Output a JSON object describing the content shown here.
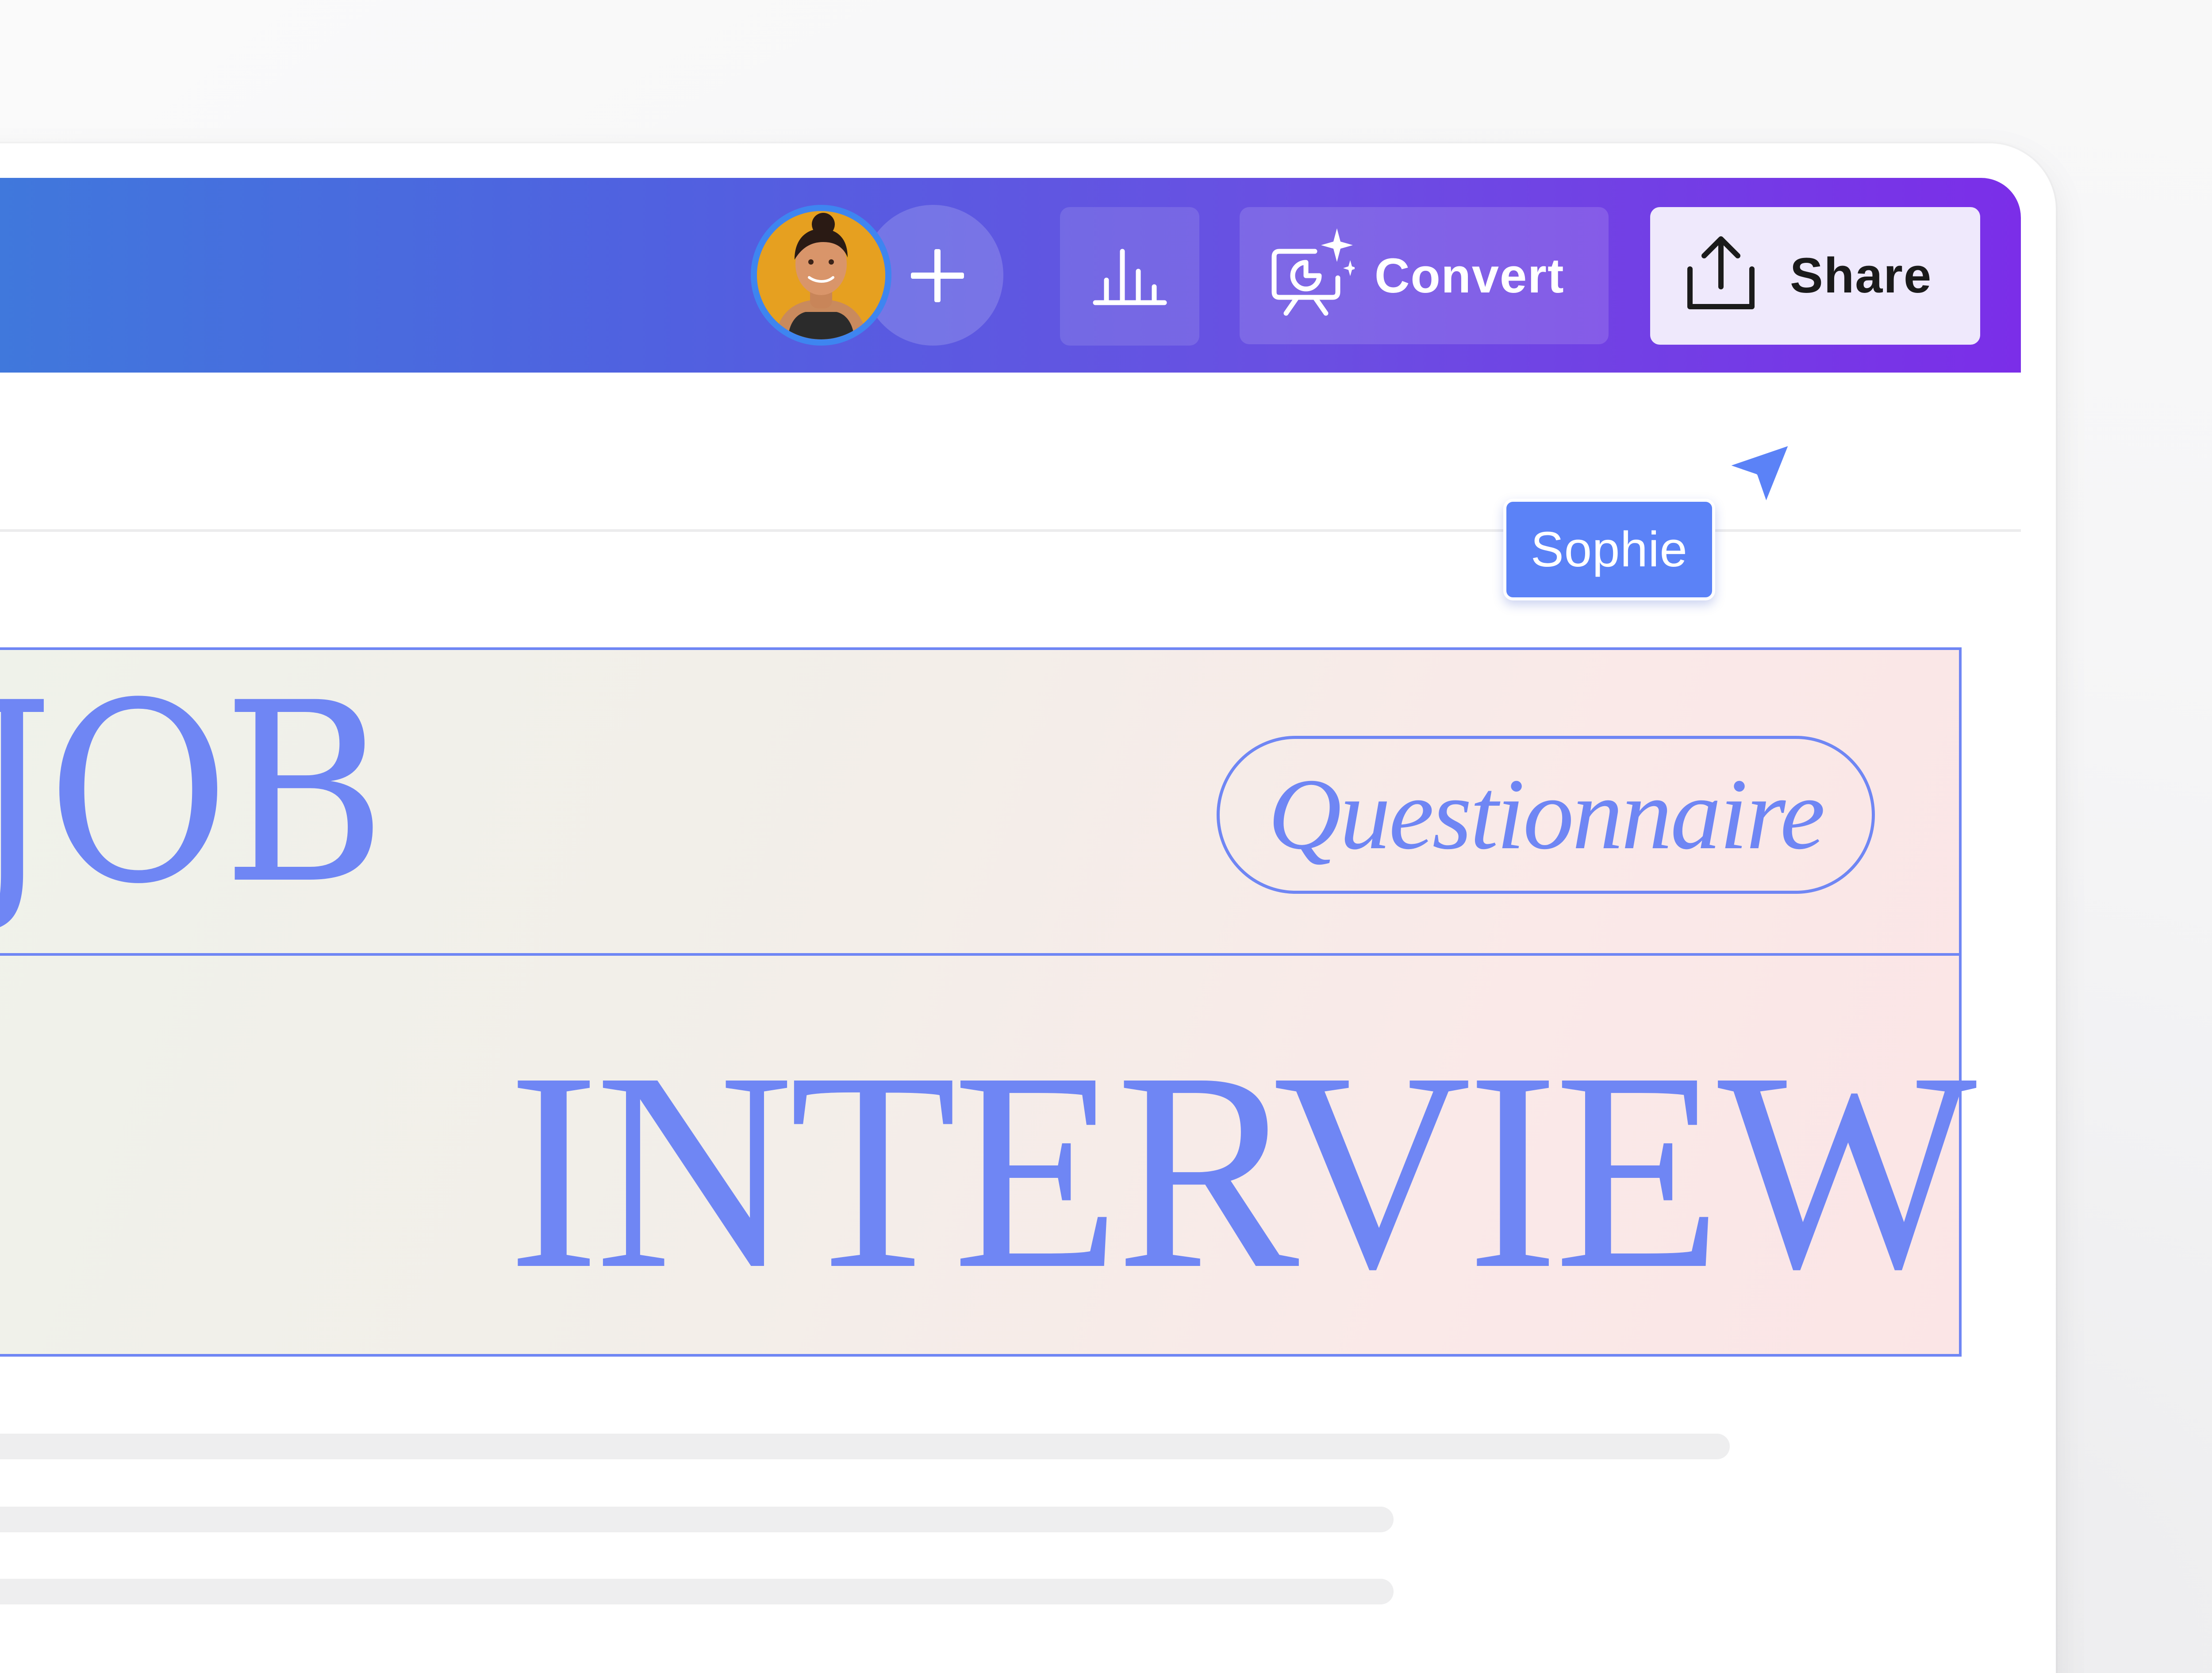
{
  "toolbar": {
    "collaborator_name": "Sophie",
    "add_people_icon": "plus-icon",
    "insights_icon": "bar-chart-icon",
    "convert_label": "Convert",
    "convert_icon": "presentation-sparkle-icon",
    "share_label": "Share",
    "share_icon": "upload-icon"
  },
  "cursor": {
    "label": "Sophie",
    "color": "#5b82f7"
  },
  "design": {
    "title_line1": "JOB",
    "badge": "Questionnaire",
    "title_line2": "INTERVIEW",
    "accent_color": "#6f86f4"
  },
  "colors": {
    "topbar_start": "#3f79dc",
    "topbar_end": "#7b2ee8",
    "share_bg": "#efe9fc"
  }
}
